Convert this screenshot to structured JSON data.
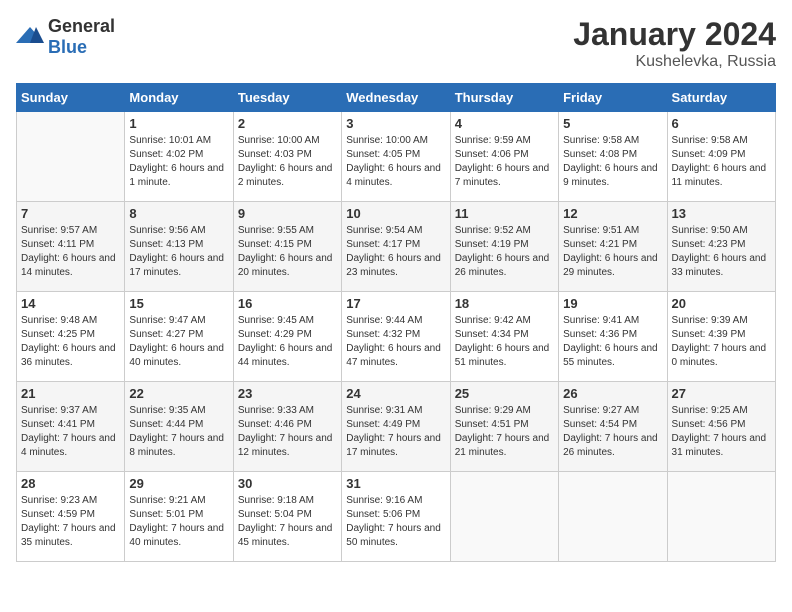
{
  "logo": {
    "general": "General",
    "blue": "Blue"
  },
  "header": {
    "month": "January 2024",
    "location": "Kushelevka, Russia"
  },
  "weekdays": [
    "Sunday",
    "Monday",
    "Tuesday",
    "Wednesday",
    "Thursday",
    "Friday",
    "Saturday"
  ],
  "weeks": [
    [
      {
        "day": "",
        "sunrise": "",
        "sunset": "",
        "daylight": ""
      },
      {
        "day": "1",
        "sunrise": "10:01 AM",
        "sunset": "4:02 PM",
        "daylight": "6 hours and 1 minute."
      },
      {
        "day": "2",
        "sunrise": "10:00 AM",
        "sunset": "4:03 PM",
        "daylight": "6 hours and 2 minutes."
      },
      {
        "day": "3",
        "sunrise": "10:00 AM",
        "sunset": "4:05 PM",
        "daylight": "6 hours and 4 minutes."
      },
      {
        "day": "4",
        "sunrise": "9:59 AM",
        "sunset": "4:06 PM",
        "daylight": "6 hours and 7 minutes."
      },
      {
        "day": "5",
        "sunrise": "9:58 AM",
        "sunset": "4:08 PM",
        "daylight": "6 hours and 9 minutes."
      },
      {
        "day": "6",
        "sunrise": "9:58 AM",
        "sunset": "4:09 PM",
        "daylight": "6 hours and 11 minutes."
      }
    ],
    [
      {
        "day": "7",
        "sunrise": "9:57 AM",
        "sunset": "4:11 PM",
        "daylight": "6 hours and 14 minutes."
      },
      {
        "day": "8",
        "sunrise": "9:56 AM",
        "sunset": "4:13 PM",
        "daylight": "6 hours and 17 minutes."
      },
      {
        "day": "9",
        "sunrise": "9:55 AM",
        "sunset": "4:15 PM",
        "daylight": "6 hours and 20 minutes."
      },
      {
        "day": "10",
        "sunrise": "9:54 AM",
        "sunset": "4:17 PM",
        "daylight": "6 hours and 23 minutes."
      },
      {
        "day": "11",
        "sunrise": "9:52 AM",
        "sunset": "4:19 PM",
        "daylight": "6 hours and 26 minutes."
      },
      {
        "day": "12",
        "sunrise": "9:51 AM",
        "sunset": "4:21 PM",
        "daylight": "6 hours and 29 minutes."
      },
      {
        "day": "13",
        "sunrise": "9:50 AM",
        "sunset": "4:23 PM",
        "daylight": "6 hours and 33 minutes."
      }
    ],
    [
      {
        "day": "14",
        "sunrise": "9:48 AM",
        "sunset": "4:25 PM",
        "daylight": "6 hours and 36 minutes."
      },
      {
        "day": "15",
        "sunrise": "9:47 AM",
        "sunset": "4:27 PM",
        "daylight": "6 hours and 40 minutes."
      },
      {
        "day": "16",
        "sunrise": "9:45 AM",
        "sunset": "4:29 PM",
        "daylight": "6 hours and 44 minutes."
      },
      {
        "day": "17",
        "sunrise": "9:44 AM",
        "sunset": "4:32 PM",
        "daylight": "6 hours and 47 minutes."
      },
      {
        "day": "18",
        "sunrise": "9:42 AM",
        "sunset": "4:34 PM",
        "daylight": "6 hours and 51 minutes."
      },
      {
        "day": "19",
        "sunrise": "9:41 AM",
        "sunset": "4:36 PM",
        "daylight": "6 hours and 55 minutes."
      },
      {
        "day": "20",
        "sunrise": "9:39 AM",
        "sunset": "4:39 PM",
        "daylight": "7 hours and 0 minutes."
      }
    ],
    [
      {
        "day": "21",
        "sunrise": "9:37 AM",
        "sunset": "4:41 PM",
        "daylight": "7 hours and 4 minutes."
      },
      {
        "day": "22",
        "sunrise": "9:35 AM",
        "sunset": "4:44 PM",
        "daylight": "7 hours and 8 minutes."
      },
      {
        "day": "23",
        "sunrise": "9:33 AM",
        "sunset": "4:46 PM",
        "daylight": "7 hours and 12 minutes."
      },
      {
        "day": "24",
        "sunrise": "9:31 AM",
        "sunset": "4:49 PM",
        "daylight": "7 hours and 17 minutes."
      },
      {
        "day": "25",
        "sunrise": "9:29 AM",
        "sunset": "4:51 PM",
        "daylight": "7 hours and 21 minutes."
      },
      {
        "day": "26",
        "sunrise": "9:27 AM",
        "sunset": "4:54 PM",
        "daylight": "7 hours and 26 minutes."
      },
      {
        "day": "27",
        "sunrise": "9:25 AM",
        "sunset": "4:56 PM",
        "daylight": "7 hours and 31 minutes."
      }
    ],
    [
      {
        "day": "28",
        "sunrise": "9:23 AM",
        "sunset": "4:59 PM",
        "daylight": "7 hours and 35 minutes."
      },
      {
        "day": "29",
        "sunrise": "9:21 AM",
        "sunset": "5:01 PM",
        "daylight": "7 hours and 40 minutes."
      },
      {
        "day": "30",
        "sunrise": "9:18 AM",
        "sunset": "5:04 PM",
        "daylight": "7 hours and 45 minutes."
      },
      {
        "day": "31",
        "sunrise": "9:16 AM",
        "sunset": "5:06 PM",
        "daylight": "7 hours and 50 minutes."
      },
      {
        "day": "",
        "sunrise": "",
        "sunset": "",
        "daylight": ""
      },
      {
        "day": "",
        "sunrise": "",
        "sunset": "",
        "daylight": ""
      },
      {
        "day": "",
        "sunrise": "",
        "sunset": "",
        "daylight": ""
      }
    ]
  ],
  "labels": {
    "sunrise": "Sunrise:",
    "sunset": "Sunset:",
    "daylight": "Daylight:"
  }
}
